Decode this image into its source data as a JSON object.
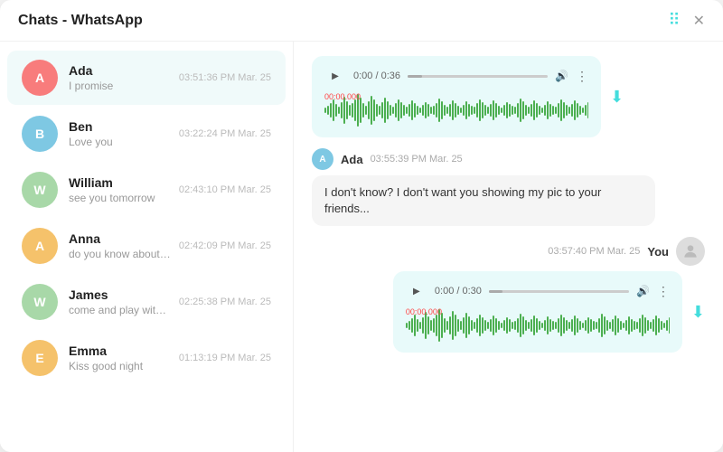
{
  "titleBar": {
    "title": "Chats - WhatsApp",
    "dotsLabel": "⠿",
    "closeLabel": "✕"
  },
  "sidebar": {
    "contacts": [
      {
        "id": "ada",
        "name": "Ada",
        "preview": "I promise",
        "time": "03:51:36 PM Mar. 25",
        "avatarColor": "#f87c7c",
        "letter": "A",
        "active": true
      },
      {
        "id": "ben",
        "name": "Ben",
        "preview": "Love you",
        "time": "03:22:24 PM Mar. 25",
        "avatarColor": "#7ec8e3",
        "letter": "B",
        "active": false
      },
      {
        "id": "william",
        "name": "William",
        "preview": "see you tomorrow",
        "time": "02:43:10 PM Mar. 25",
        "avatarColor": "#a8d8a8",
        "letter": "W",
        "active": false
      },
      {
        "id": "anna",
        "name": "Anna",
        "preview": "do you know about that",
        "time": "02:42:09 PM Mar. 25",
        "avatarColor": "#f5c26b",
        "letter": "A",
        "active": false
      },
      {
        "id": "james",
        "name": "James",
        "preview": "come and play with me",
        "time": "02:25:38 PM Mar. 25",
        "avatarColor": "#a8d8a8",
        "letter": "W",
        "active": false
      },
      {
        "id": "emma",
        "name": "Emma",
        "preview": "Kiss good night",
        "time": "01:13:19 PM Mar. 25",
        "avatarColor": "#f5c26b",
        "letter": "E",
        "active": false
      }
    ]
  },
  "chatArea": {
    "audio1": {
      "time": "0:00",
      "duration": "0:36",
      "downloadLabel": "⬇"
    },
    "message1": {
      "sender": "Ada",
      "timestamp": "03:55:39 PM Mar. 25",
      "avatarLetter": "A",
      "avatarColor": "#7ec8e3",
      "text": "I don't know? I don't want you showing my pic to your friends..."
    },
    "outgoing": {
      "timestamp": "03:57:40 PM Mar. 25",
      "you": "You"
    },
    "audio2": {
      "time": "0:00",
      "duration": "0:30",
      "downloadLabel": "⬇"
    }
  },
  "waveform1": [
    3,
    5,
    8,
    12,
    7,
    4,
    9,
    15,
    10,
    6,
    8,
    12,
    18,
    14,
    8,
    5,
    10,
    16,
    12,
    7,
    5,
    9,
    14,
    10,
    6,
    4,
    8,
    12,
    9,
    6,
    4,
    7,
    11,
    8,
    5,
    3,
    6,
    9,
    7,
    4,
    5,
    8,
    13,
    10,
    6,
    4,
    7,
    11,
    8,
    5,
    3,
    6,
    10,
    7,
    5,
    4,
    8,
    12,
    9,
    6,
    4,
    7,
    11,
    8,
    5,
    3,
    6,
    9,
    7,
    5,
    4,
    8,
    13,
    10,
    6,
    4,
    7,
    11,
    8,
    5,
    3,
    6,
    10,
    7,
    5,
    4,
    8,
    12,
    9,
    6,
    4,
    7,
    11,
    8,
    5,
    3,
    6,
    9,
    7,
    5,
    4,
    8,
    13,
    10,
    6,
    4,
    7,
    11,
    8,
    5,
    6,
    10,
    15,
    12,
    8,
    6,
    10,
    14,
    11,
    7,
    5,
    9,
    13,
    10,
    6
  ],
  "waveform2": [
    3,
    5,
    8,
    12,
    7,
    4,
    9,
    15,
    10,
    6,
    8,
    12,
    18,
    14,
    8,
    5,
    10,
    16,
    12,
    7,
    5,
    9,
    14,
    10,
    6,
    4,
    8,
    12,
    9,
    6,
    4,
    7,
    11,
    8,
    5,
    3,
    6,
    9,
    7,
    4,
    5,
    8,
    13,
    10,
    6,
    4,
    7,
    11,
    8,
    5,
    3,
    6,
    10,
    7,
    5,
    4,
    8,
    12,
    9,
    6,
    4,
    7,
    11,
    8,
    5,
    3,
    6,
    9,
    7,
    5,
    4,
    8,
    13,
    10,
    6,
    4,
    7,
    11,
    8,
    5,
    3,
    6,
    10,
    7,
    5,
    4,
    8,
    12,
    9,
    6,
    4,
    7,
    11,
    8,
    5,
    3,
    6,
    9,
    7,
    5,
    4,
    8,
    13,
    10,
    6,
    4,
    7,
    11,
    8,
    5,
    6,
    10,
    15,
    12,
    8,
    6,
    10,
    14,
    11,
    7,
    5,
    9,
    13,
    10,
    6
  ]
}
